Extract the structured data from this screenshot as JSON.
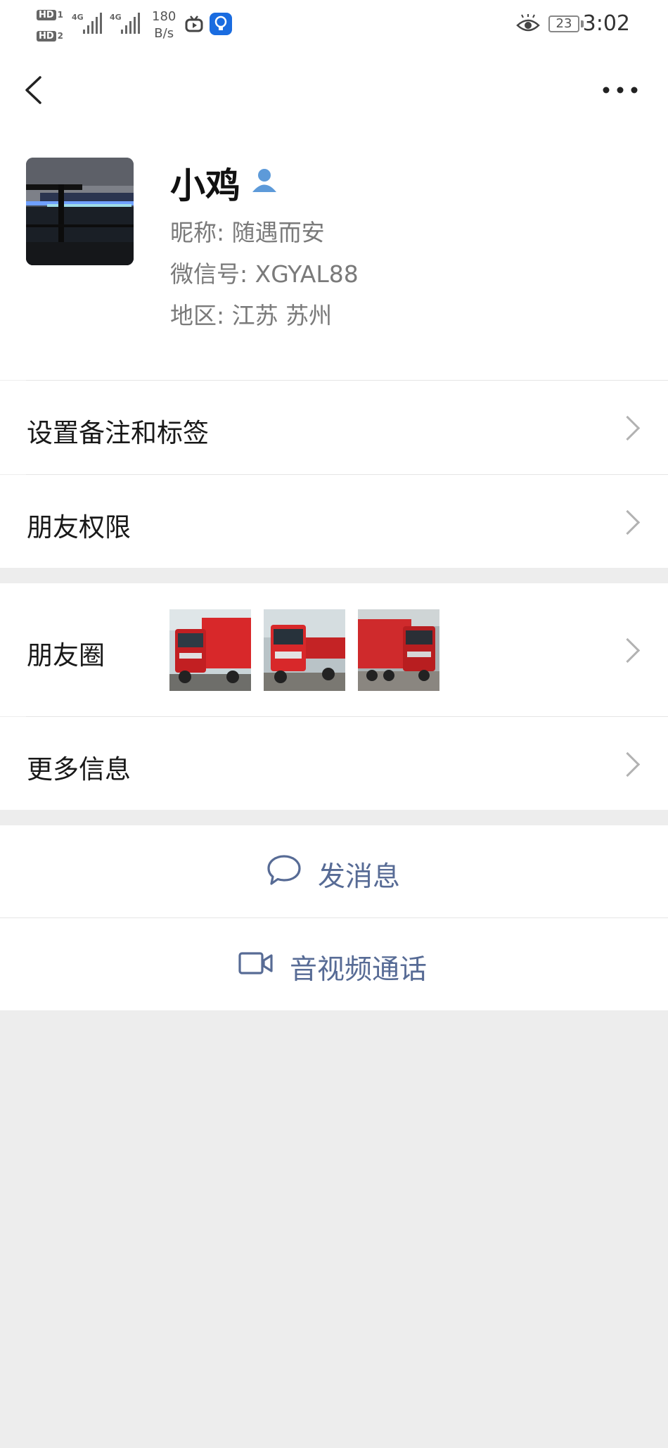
{
  "status_bar": {
    "hd1": "HD",
    "hd1_sub": "1",
    "hd2": "HD",
    "hd2_sub": "2",
    "net1": "4G",
    "net2": "4G",
    "speed_value": "180",
    "speed_unit": "B/s",
    "battery": "23",
    "time": "3:02"
  },
  "profile": {
    "name": "小鸡",
    "nickname": "昵称:  随遇而安",
    "wechat_id": "微信号:  XGYAL88",
    "region": "地区:  江苏  苏州"
  },
  "menu": {
    "remark_label": "设置备注和标签",
    "permissions_label": "朋友权限",
    "moments_label": "朋友圈",
    "more_info_label": "更多信息"
  },
  "actions": {
    "message_label": "发消息",
    "call_label": "音视频通话"
  },
  "colors": {
    "link_blue": "#576b95",
    "background": "#ededed",
    "truck_red": "#d8282a"
  }
}
